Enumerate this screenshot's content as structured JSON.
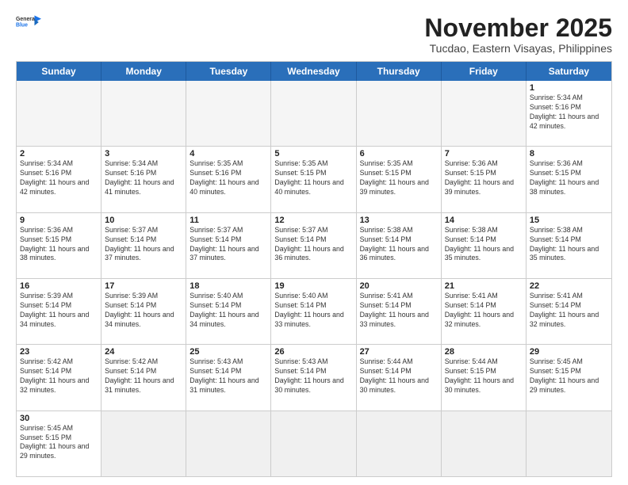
{
  "header": {
    "logo_general": "General",
    "logo_blue": "Blue",
    "month_title": "November 2025",
    "location": "Tucdao, Eastern Visayas, Philippines"
  },
  "weekdays": [
    "Sunday",
    "Monday",
    "Tuesday",
    "Wednesday",
    "Thursday",
    "Friday",
    "Saturday"
  ],
  "rows": [
    [
      {
        "day": "",
        "sunrise": "",
        "sunset": "",
        "daylight": "",
        "empty": true
      },
      {
        "day": "",
        "sunrise": "",
        "sunset": "",
        "daylight": "",
        "empty": true
      },
      {
        "day": "",
        "sunrise": "",
        "sunset": "",
        "daylight": "",
        "empty": true
      },
      {
        "day": "",
        "sunrise": "",
        "sunset": "",
        "daylight": "",
        "empty": true
      },
      {
        "day": "",
        "sunrise": "",
        "sunset": "",
        "daylight": "",
        "empty": true
      },
      {
        "day": "",
        "sunrise": "",
        "sunset": "",
        "daylight": "",
        "empty": true
      },
      {
        "day": "1",
        "sunrise": "Sunrise: 5:34 AM",
        "sunset": "Sunset: 5:16 PM",
        "daylight": "Daylight: 11 hours and 42 minutes.",
        "empty": false
      }
    ],
    [
      {
        "day": "2",
        "sunrise": "Sunrise: 5:34 AM",
        "sunset": "Sunset: 5:16 PM",
        "daylight": "Daylight: 11 hours and 42 minutes.",
        "empty": false
      },
      {
        "day": "3",
        "sunrise": "Sunrise: 5:34 AM",
        "sunset": "Sunset: 5:16 PM",
        "daylight": "Daylight: 11 hours and 41 minutes.",
        "empty": false
      },
      {
        "day": "4",
        "sunrise": "Sunrise: 5:35 AM",
        "sunset": "Sunset: 5:16 PM",
        "daylight": "Daylight: 11 hours and 40 minutes.",
        "empty": false
      },
      {
        "day": "5",
        "sunrise": "Sunrise: 5:35 AM",
        "sunset": "Sunset: 5:15 PM",
        "daylight": "Daylight: 11 hours and 40 minutes.",
        "empty": false
      },
      {
        "day": "6",
        "sunrise": "Sunrise: 5:35 AM",
        "sunset": "Sunset: 5:15 PM",
        "daylight": "Daylight: 11 hours and 39 minutes.",
        "empty": false
      },
      {
        "day": "7",
        "sunrise": "Sunrise: 5:36 AM",
        "sunset": "Sunset: 5:15 PM",
        "daylight": "Daylight: 11 hours and 39 minutes.",
        "empty": false
      },
      {
        "day": "8",
        "sunrise": "Sunrise: 5:36 AM",
        "sunset": "Sunset: 5:15 PM",
        "daylight": "Daylight: 11 hours and 38 minutes.",
        "empty": false
      }
    ],
    [
      {
        "day": "9",
        "sunrise": "Sunrise: 5:36 AM",
        "sunset": "Sunset: 5:15 PM",
        "daylight": "Daylight: 11 hours and 38 minutes.",
        "empty": false
      },
      {
        "day": "10",
        "sunrise": "Sunrise: 5:37 AM",
        "sunset": "Sunset: 5:14 PM",
        "daylight": "Daylight: 11 hours and 37 minutes.",
        "empty": false
      },
      {
        "day": "11",
        "sunrise": "Sunrise: 5:37 AM",
        "sunset": "Sunset: 5:14 PM",
        "daylight": "Daylight: 11 hours and 37 minutes.",
        "empty": false
      },
      {
        "day": "12",
        "sunrise": "Sunrise: 5:37 AM",
        "sunset": "Sunset: 5:14 PM",
        "daylight": "Daylight: 11 hours and 36 minutes.",
        "empty": false
      },
      {
        "day": "13",
        "sunrise": "Sunrise: 5:38 AM",
        "sunset": "Sunset: 5:14 PM",
        "daylight": "Daylight: 11 hours and 36 minutes.",
        "empty": false
      },
      {
        "day": "14",
        "sunrise": "Sunrise: 5:38 AM",
        "sunset": "Sunset: 5:14 PM",
        "daylight": "Daylight: 11 hours and 35 minutes.",
        "empty": false
      },
      {
        "day": "15",
        "sunrise": "Sunrise: 5:38 AM",
        "sunset": "Sunset: 5:14 PM",
        "daylight": "Daylight: 11 hours and 35 minutes.",
        "empty": false
      }
    ],
    [
      {
        "day": "16",
        "sunrise": "Sunrise: 5:39 AM",
        "sunset": "Sunset: 5:14 PM",
        "daylight": "Daylight: 11 hours and 34 minutes.",
        "empty": false
      },
      {
        "day": "17",
        "sunrise": "Sunrise: 5:39 AM",
        "sunset": "Sunset: 5:14 PM",
        "daylight": "Daylight: 11 hours and 34 minutes.",
        "empty": false
      },
      {
        "day": "18",
        "sunrise": "Sunrise: 5:40 AM",
        "sunset": "Sunset: 5:14 PM",
        "daylight": "Daylight: 11 hours and 34 minutes.",
        "empty": false
      },
      {
        "day": "19",
        "sunrise": "Sunrise: 5:40 AM",
        "sunset": "Sunset: 5:14 PM",
        "daylight": "Daylight: 11 hours and 33 minutes.",
        "empty": false
      },
      {
        "day": "20",
        "sunrise": "Sunrise: 5:41 AM",
        "sunset": "Sunset: 5:14 PM",
        "daylight": "Daylight: 11 hours and 33 minutes.",
        "empty": false
      },
      {
        "day": "21",
        "sunrise": "Sunrise: 5:41 AM",
        "sunset": "Sunset: 5:14 PM",
        "daylight": "Daylight: 11 hours and 32 minutes.",
        "empty": false
      },
      {
        "day": "22",
        "sunrise": "Sunrise: 5:41 AM",
        "sunset": "Sunset: 5:14 PM",
        "daylight": "Daylight: 11 hours and 32 minutes.",
        "empty": false
      }
    ],
    [
      {
        "day": "23",
        "sunrise": "Sunrise: 5:42 AM",
        "sunset": "Sunset: 5:14 PM",
        "daylight": "Daylight: 11 hours and 32 minutes.",
        "empty": false
      },
      {
        "day": "24",
        "sunrise": "Sunrise: 5:42 AM",
        "sunset": "Sunset: 5:14 PM",
        "daylight": "Daylight: 11 hours and 31 minutes.",
        "empty": false
      },
      {
        "day": "25",
        "sunrise": "Sunrise: 5:43 AM",
        "sunset": "Sunset: 5:14 PM",
        "daylight": "Daylight: 11 hours and 31 minutes.",
        "empty": false
      },
      {
        "day": "26",
        "sunrise": "Sunrise: 5:43 AM",
        "sunset": "Sunset: 5:14 PM",
        "daylight": "Daylight: 11 hours and 30 minutes.",
        "empty": false
      },
      {
        "day": "27",
        "sunrise": "Sunrise: 5:44 AM",
        "sunset": "Sunset: 5:14 PM",
        "daylight": "Daylight: 11 hours and 30 minutes.",
        "empty": false
      },
      {
        "day": "28",
        "sunrise": "Sunrise: 5:44 AM",
        "sunset": "Sunset: 5:15 PM",
        "daylight": "Daylight: 11 hours and 30 minutes.",
        "empty": false
      },
      {
        "day": "29",
        "sunrise": "Sunrise: 5:45 AM",
        "sunset": "Sunset: 5:15 PM",
        "daylight": "Daylight: 11 hours and 29 minutes.",
        "empty": false
      }
    ],
    [
      {
        "day": "30",
        "sunrise": "Sunrise: 5:45 AM",
        "sunset": "Sunset: 5:15 PM",
        "daylight": "Daylight: 11 hours and 29 minutes.",
        "empty": false
      },
      {
        "day": "",
        "sunrise": "",
        "sunset": "",
        "daylight": "",
        "empty": true
      },
      {
        "day": "",
        "sunrise": "",
        "sunset": "",
        "daylight": "",
        "empty": true
      },
      {
        "day": "",
        "sunrise": "",
        "sunset": "",
        "daylight": "",
        "empty": true
      },
      {
        "day": "",
        "sunrise": "",
        "sunset": "",
        "daylight": "",
        "empty": true
      },
      {
        "day": "",
        "sunrise": "",
        "sunset": "",
        "daylight": "",
        "empty": true
      },
      {
        "day": "",
        "sunrise": "",
        "sunset": "",
        "daylight": "",
        "empty": true
      }
    ]
  ]
}
